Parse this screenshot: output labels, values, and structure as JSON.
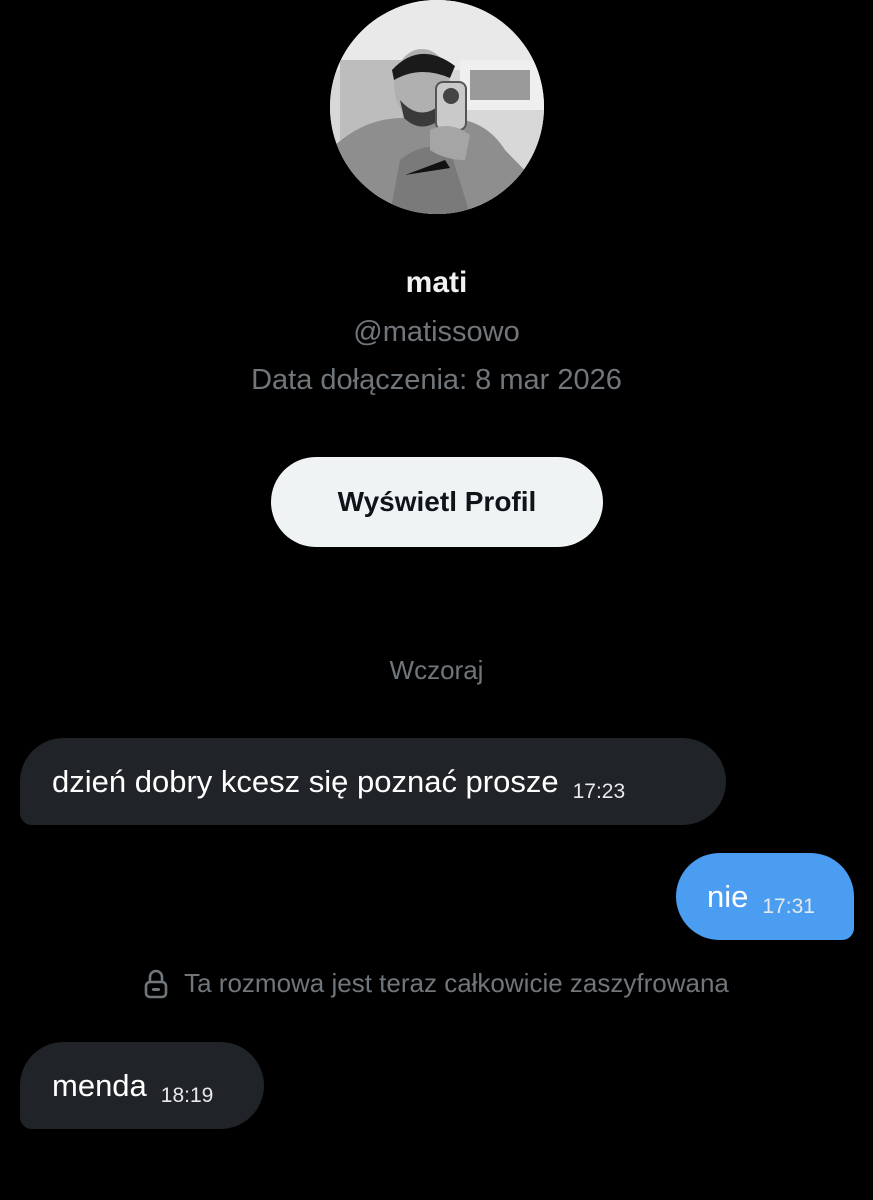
{
  "profile": {
    "name": "mati",
    "handle": "@matissowo",
    "joined": "Data dołączenia: 8 mar 2026",
    "view_profile_label": "Wyświetl Profil"
  },
  "conversation": {
    "day_separator": "Wczoraj",
    "encryption_notice": "Ta rozmowa jest teraz całkowicie zaszyfrowana",
    "messages": [
      {
        "direction": "incoming",
        "text": "dzień dobry kcesz się poznać prosze",
        "time": "17:23"
      },
      {
        "direction": "outgoing",
        "text": "nie",
        "time": "17:31"
      },
      {
        "direction": "incoming",
        "text": "menda",
        "time": "18:19"
      }
    ]
  },
  "icons": {
    "lock": "lock-icon"
  },
  "colors": {
    "background": "#000000",
    "incoming_bubble": "#202327",
    "outgoing_bubble": "#4a9df0",
    "muted_text": "#71767b",
    "button_bg": "#eff3f4"
  }
}
